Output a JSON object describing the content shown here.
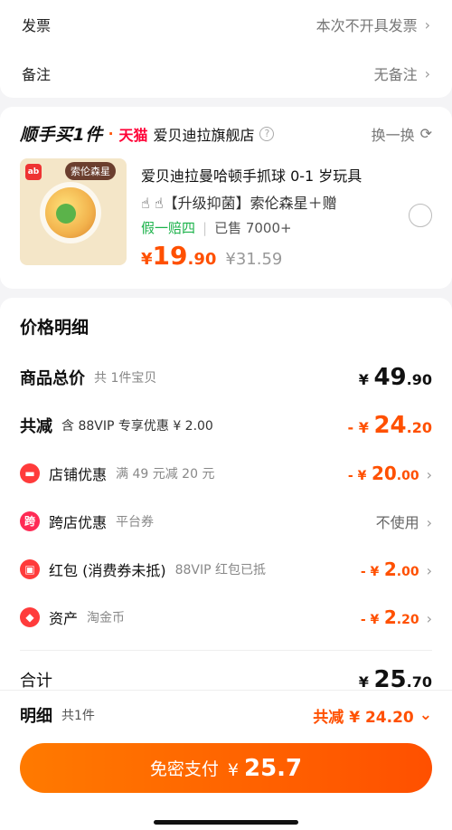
{
  "top": {
    "invoice_label": "发票",
    "invoice_value": "本次不开具发票",
    "note_label": "备注",
    "note_value": "无备注"
  },
  "reco": {
    "title": "顺手买1件",
    "tmall": "天猫",
    "shop": "爱贝迪拉旗舰店",
    "swap_label": "换一换",
    "product": {
      "name_line1": "爱贝迪拉曼哈顿手抓球 0-1 岁玩具",
      "name_line2": "☝ ☝【升级抑菌】索伦森星＋赠",
      "badge_guarantee": "假一赔四",
      "sold": "已售 7000+",
      "price_symbol": "¥",
      "price_int": "19",
      "price_dec": ".90",
      "orig_price": "¥31.59",
      "thumb_tag": "索伦森星"
    }
  },
  "detail": {
    "heading": "价格明细",
    "goods_total": {
      "label": "商品总价",
      "sub": "共 1件宝贝",
      "symbol": "¥",
      "int": "49",
      "dec": ".90"
    },
    "discount_total": {
      "label": "共减",
      "sub": "含 88VIP 专享优惠 ¥ 2.00",
      "symbol": "- ¥",
      "int": "24",
      "dec": ".20"
    },
    "shop_discount": {
      "label": "店铺优惠",
      "sub": "满 49 元减 20 元",
      "symbol": "- ¥",
      "int": "20",
      "dec": ".00"
    },
    "cross_discount": {
      "label": "跨店优惠",
      "sub": "平台券",
      "value": "不使用"
    },
    "redpack": {
      "label": "红包 (消费券未抵)",
      "sub": "88VIP 红包已抵",
      "symbol": "- ¥",
      "int": "2",
      "dec": ".00"
    },
    "assets": {
      "label": "资产",
      "sub": "淘金币",
      "symbol": "- ¥",
      "int": "2",
      "dec": ".20"
    },
    "total": {
      "label": "合计",
      "symbol": "¥",
      "int": "25",
      "dec": ".70"
    }
  },
  "footer": {
    "detail_label": "明细",
    "count": "共1件",
    "saved": "共减 ¥ 24.20",
    "pay_label": "免密支付",
    "pay_symbol": "¥",
    "pay_amount": "25.7"
  },
  "colors": {
    "accent": "#ff5000",
    "tmall": "#ff0036",
    "green": "#1bb24a"
  }
}
